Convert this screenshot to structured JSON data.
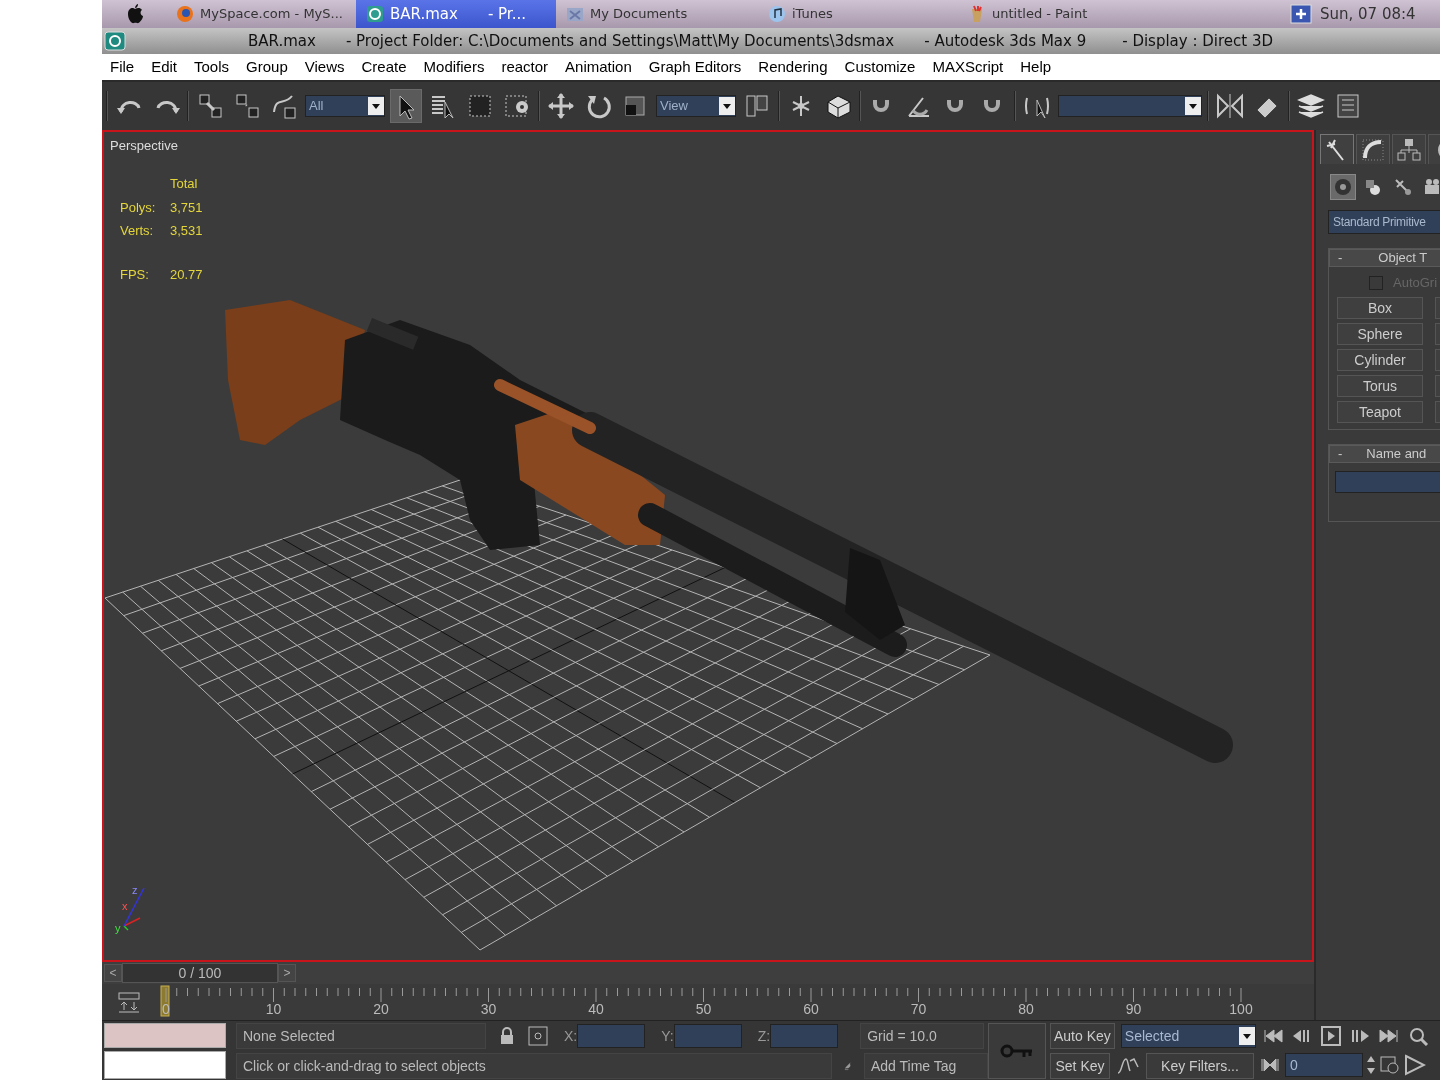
{
  "taskbar": {
    "items": [
      {
        "kind": "browser",
        "label": "MySpace.com - MyS...",
        "selected": false
      },
      {
        "kind": "max",
        "label": "BAR.max",
        "detail": "- Pr...",
        "selected": true
      },
      {
        "kind": "folder",
        "label": "My Documents",
        "selected": false
      },
      {
        "kind": "music",
        "label": "iTunes",
        "selected": false
      },
      {
        "kind": "paint",
        "label": "untitled - Paint",
        "selected": false
      }
    ],
    "clock": "Sun, 07 08:4"
  },
  "title_bar": {
    "segments": [
      "BAR.max",
      "- Project Folder: C:\\Documents and Settings\\Matt\\My Documents\\3dsmax",
      "- Autodesk 3ds Max 9",
      "- Display : Direct 3D"
    ]
  },
  "menu": [
    "File",
    "Edit",
    "Tools",
    "Group",
    "Views",
    "Create",
    "Modifiers",
    "reactor",
    "Animation",
    "Graph Editors",
    "Rendering",
    "Customize",
    "MAXScript",
    "Help"
  ],
  "toolbar": {
    "selection_filter": "All",
    "reference_coord": "View",
    "select_tool_selected": true
  },
  "viewport": {
    "label": "Perspective",
    "active": true,
    "stats": {
      "header": "Total",
      "rows": [
        {
          "label": "Polys:",
          "value": "3,751"
        },
        {
          "label": "Verts:",
          "value": "3,531"
        }
      ],
      "fps_label": "FPS:",
      "fps": "20.77"
    },
    "axis_labels": [
      "x",
      "y",
      "z"
    ]
  },
  "command_panel": {
    "tabs": [
      {
        "selected": true
      },
      {
        "selected": false
      },
      {
        "selected": false
      },
      {
        "selected": false
      }
    ],
    "categories": [
      {
        "selected": true
      },
      {
        "selected": false
      },
      {
        "selected": false
      },
      {
        "selected": false
      }
    ],
    "type_dropdown": "Standard Primitive",
    "object_type": {
      "toggle": "-",
      "title": "Object T",
      "autogrid": {
        "label": "AutoGri",
        "checked": false
      },
      "buttons": [
        "Box",
        "Sphere",
        "Cylinder",
        "Torus",
        "Teapot"
      ]
    },
    "name_and_color": {
      "toggle": "-",
      "title": "Name and"
    }
  },
  "time_slider": {
    "prev": "<",
    "position": "0 / 100",
    "next": ">"
  },
  "track_bar": {
    "ticks": [
      "0",
      "10",
      "20",
      "30",
      "40",
      "50",
      "60",
      "70",
      "80",
      "90",
      "100"
    ]
  },
  "status": {
    "selection": "None Selected",
    "coords": [
      "X:",
      "Y:",
      "Z:"
    ],
    "grid": "Grid = 10.0",
    "prompt": "Click or click-and-drag to select objects",
    "time_tag": "Add Time Tag",
    "auto_key": "Auto Key",
    "set_key": "Set Key",
    "key_mode": "Selected",
    "key_filters": "Key Filters...",
    "current_frame": "0"
  }
}
